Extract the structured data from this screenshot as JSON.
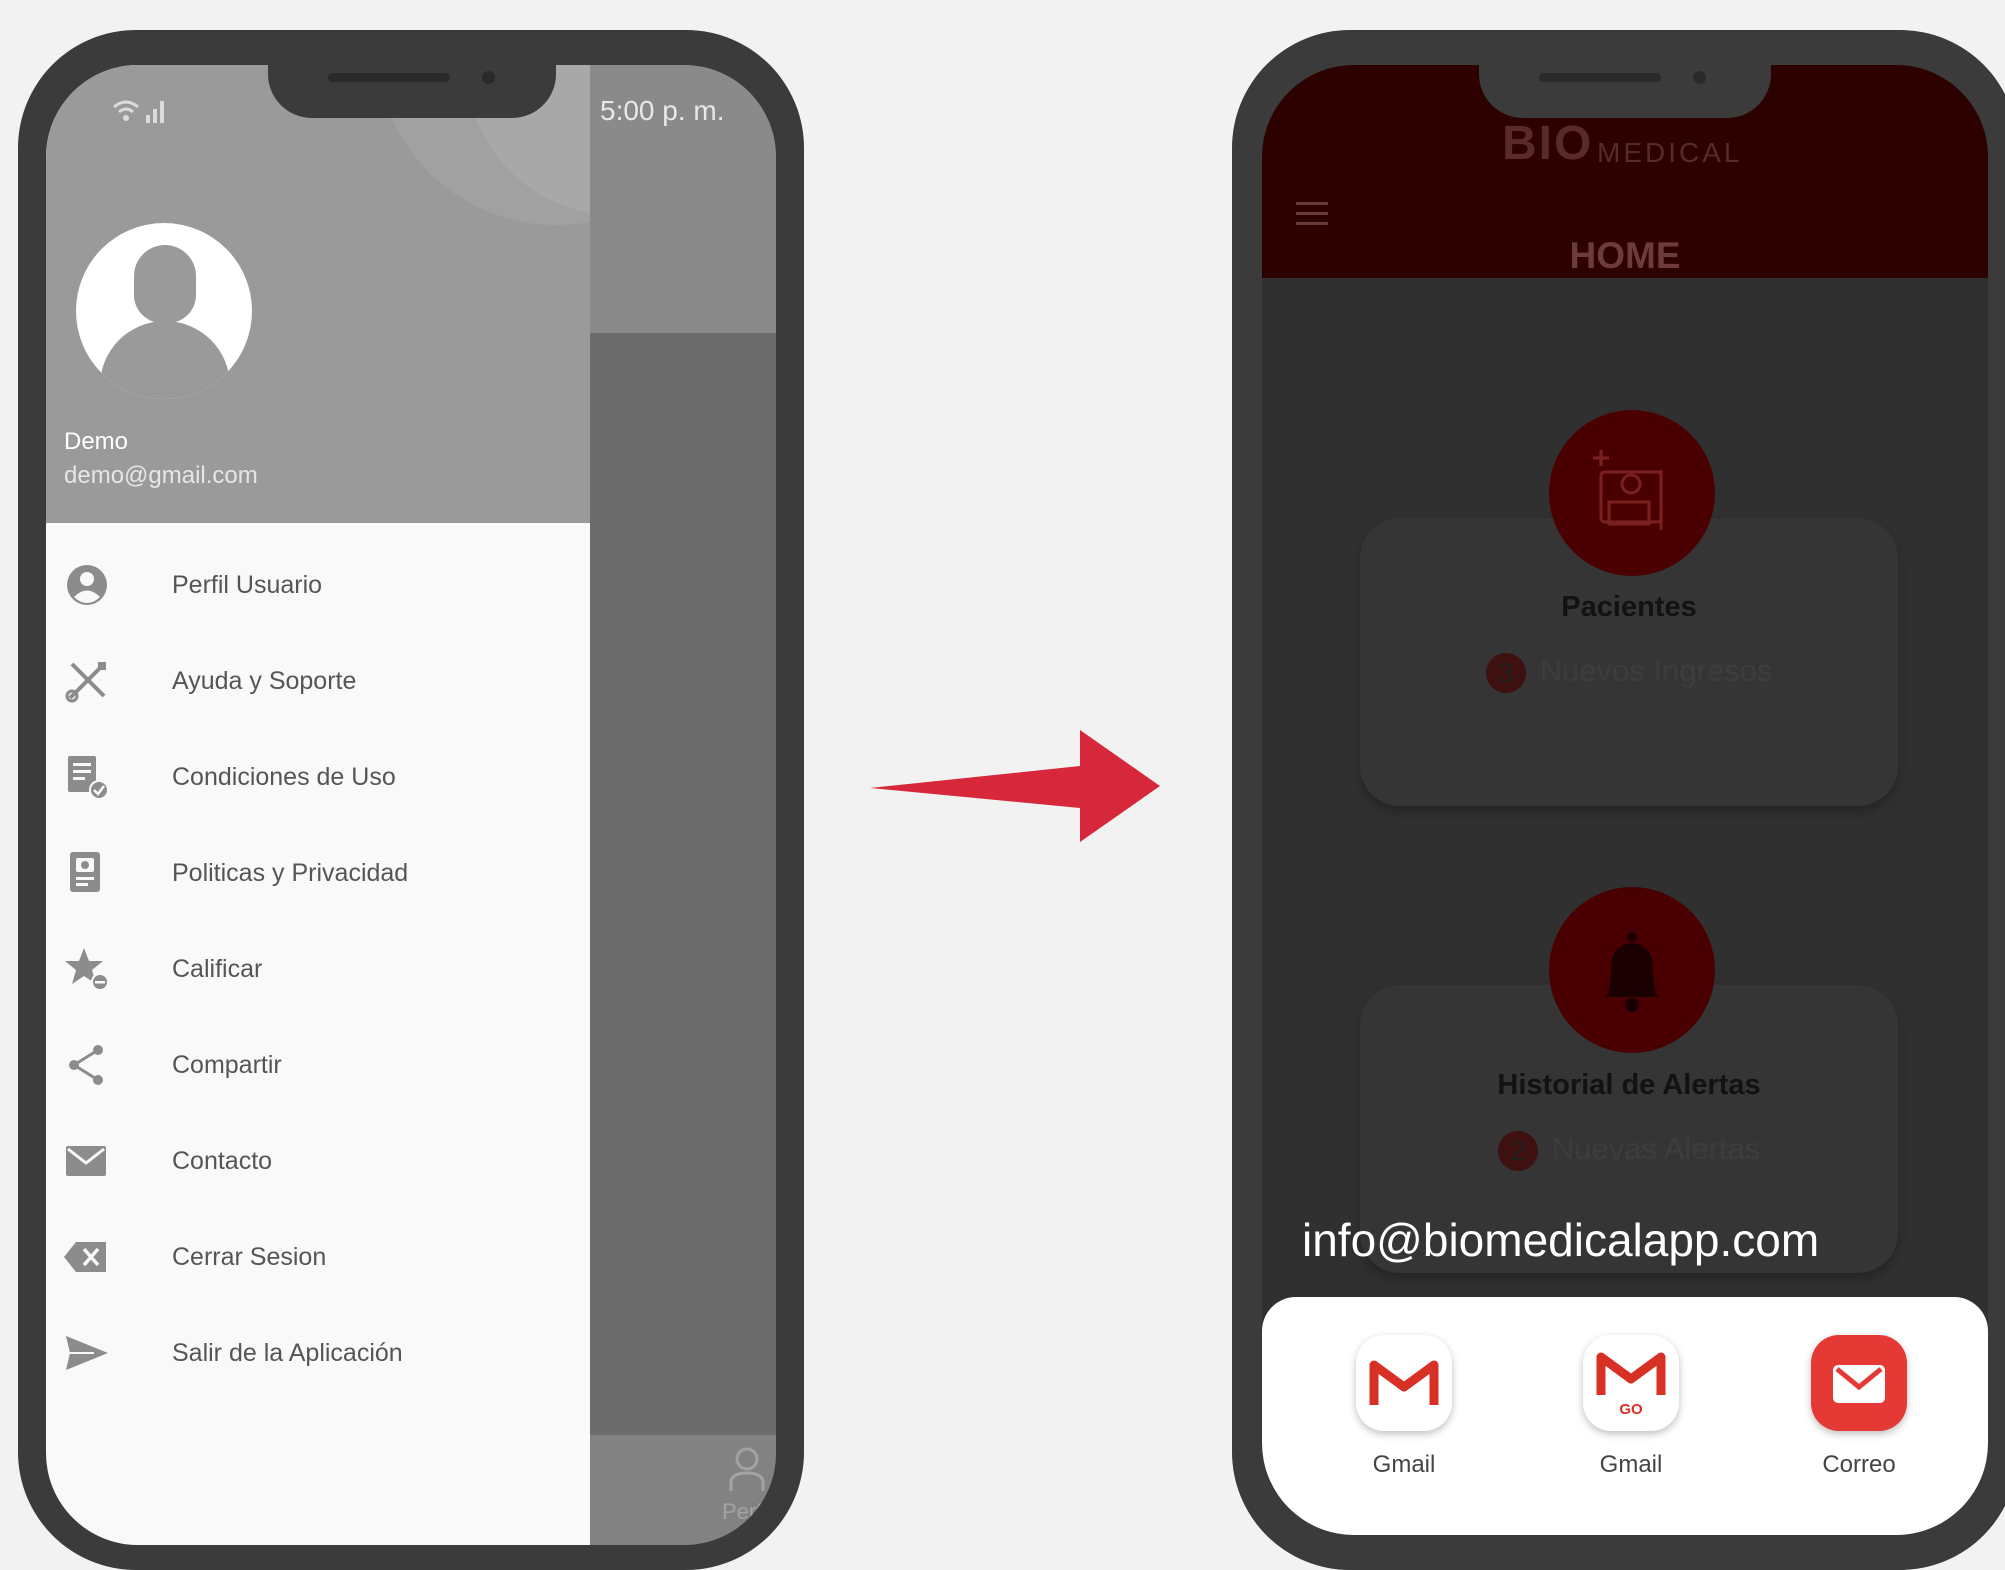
{
  "left_phone": {
    "status_bar": {
      "time": "5:00 p. m.",
      "signal_icons": "wifi-signal-icon"
    },
    "drawer": {
      "user_name": "Demo",
      "user_email": "demo@gmail.com",
      "menu_items": [
        {
          "label": "Perfil Usuario",
          "icon": "user-circle-icon"
        },
        {
          "label": "Ayuda y Soporte",
          "icon": "tools-icon"
        },
        {
          "label": "Condiciones de Uso",
          "icon": "document-check-icon"
        },
        {
          "label": "Politicas y Privacidad",
          "icon": "scroll-icon"
        },
        {
          "label": "Calificar",
          "icon": "star-icon"
        },
        {
          "label": "Compartir",
          "icon": "share-icon"
        },
        {
          "label": "Contacto",
          "icon": "envelope-icon"
        },
        {
          "label": "Cerrar Sesion",
          "icon": "backspace-icon"
        },
        {
          "label": "Salir de la Aplicación",
          "icon": "send-icon"
        }
      ]
    },
    "bottom_nav_label": "Perfil"
  },
  "right_phone": {
    "brand_bio": "BIO",
    "brand_medical": "MEDICAL",
    "page_title": "HOME",
    "cards": [
      {
        "title": "Pacientes",
        "badge": "3",
        "subtitle": "Nuevos Ingresos",
        "icon": "patient-bed-icon"
      },
      {
        "title": "Historial de Alertas",
        "badge": "2",
        "subtitle": "Nuevas Alertas",
        "icon": "bell-icon"
      }
    ],
    "share_target_email": "info@biomedicalapp.com",
    "share_apps": [
      {
        "label": "Gmail",
        "icon": "gmail-icon"
      },
      {
        "label": "Gmail",
        "icon": "gmail-go-icon",
        "badge_text": "GO"
      },
      {
        "label": "Correo",
        "icon": "mail-app-icon"
      }
    ]
  },
  "colors": {
    "brand_red": "#d6283a",
    "header_dark_red": "#2c0100",
    "drawer_header_gray": "#9a9a9a",
    "overlay_gray": "#6a6a6a"
  }
}
